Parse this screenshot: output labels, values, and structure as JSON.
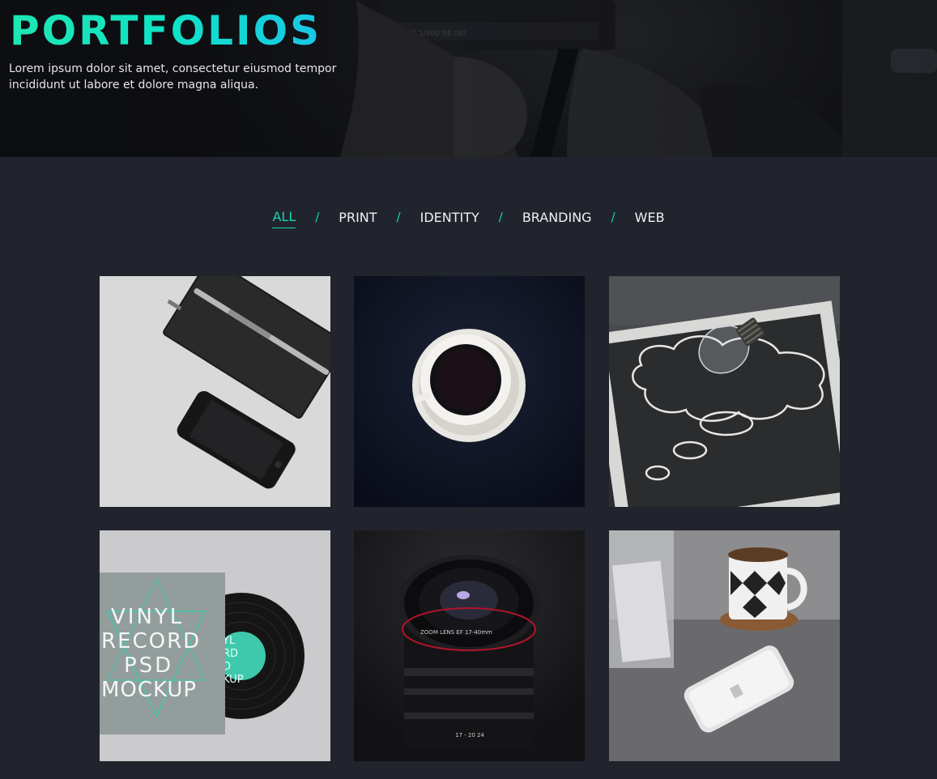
{
  "hero": {
    "title": "PORTFOLIOS",
    "subtitle": "Lorem ipsum dolor sit amet, consectetur eiusmod tempor incididunt ut labore et dolore magna aliqua."
  },
  "filters": {
    "items": [
      "ALL",
      "PRINT",
      "IDENTITY",
      "BRANDING",
      "WEB"
    ],
    "active": "ALL",
    "separator": "/"
  },
  "portfolio": {
    "items": [
      {
        "name": "notebook-pen-phone"
      },
      {
        "name": "coffee-cup"
      },
      {
        "name": "lightbulb-chalkboard"
      },
      {
        "name": "vinyl-record-mockup",
        "cover_text": [
          "VINYL",
          "RECORD",
          "PSD",
          "MOCKUP"
        ],
        "label_text": [
          "YL",
          "RD",
          "D",
          "KUP"
        ]
      },
      {
        "name": "camera-lens",
        "lens_text": "ZOOM LENS EF 17-40mm",
        "scale_text": "17 - 20  24"
      },
      {
        "name": "coffee-mug-phone"
      }
    ]
  },
  "colors": {
    "accent": "#12d6b0",
    "background": "#21242d",
    "hero_dark": "#131418"
  }
}
